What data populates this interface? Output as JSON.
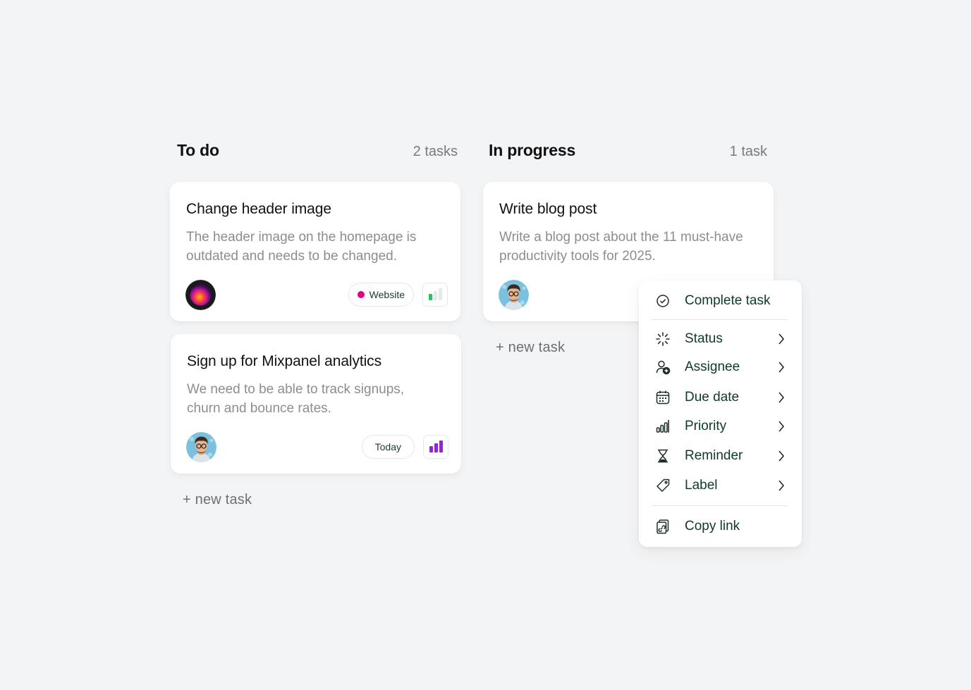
{
  "columns": [
    {
      "title": "To do",
      "count": "2 tasks",
      "new_task": "+ new task",
      "cards": [
        {
          "title": "Change header image",
          "description": "The header image on the homepage is outdated and needs to be changed.",
          "tag": {
            "label": "Website",
            "dot_color": "#e6007e"
          },
          "priority": 1
        },
        {
          "title": "Sign up for Mixpanel analytics",
          "description": "We need to be able to track signups, churn and bounce rates.",
          "tag": {
            "label": "Today"
          },
          "priority": 3
        }
      ]
    },
    {
      "title": "In progress",
      "count": "1 task",
      "new_task": "+ new task",
      "cards": [
        {
          "title": "Write blog post",
          "description": "Write a blog post about the 11 must-have productivity tools for 2025."
        }
      ]
    }
  ],
  "context_menu": {
    "items": [
      {
        "label": "Complete task",
        "icon": "check-circle-icon"
      },
      {
        "label": "Status",
        "icon": "loader-icon",
        "submenu": true
      },
      {
        "label": "Assignee",
        "icon": "user-add-icon",
        "submenu": true
      },
      {
        "label": "Due date",
        "icon": "calendar-icon",
        "submenu": true
      },
      {
        "label": "Priority",
        "icon": "signal-bars-icon",
        "submenu": true
      },
      {
        "label": "Reminder",
        "icon": "hourglass-icon",
        "submenu": true
      },
      {
        "label": "Label",
        "icon": "tag-icon",
        "submenu": true
      },
      {
        "label": "Copy link",
        "icon": "copy-link-icon"
      }
    ]
  },
  "colors": {
    "accent_text": "#0d3a2c",
    "priority_low": "#22c55e",
    "priority_high": "#9d1fd6",
    "tag_dot": "#e6007e"
  }
}
